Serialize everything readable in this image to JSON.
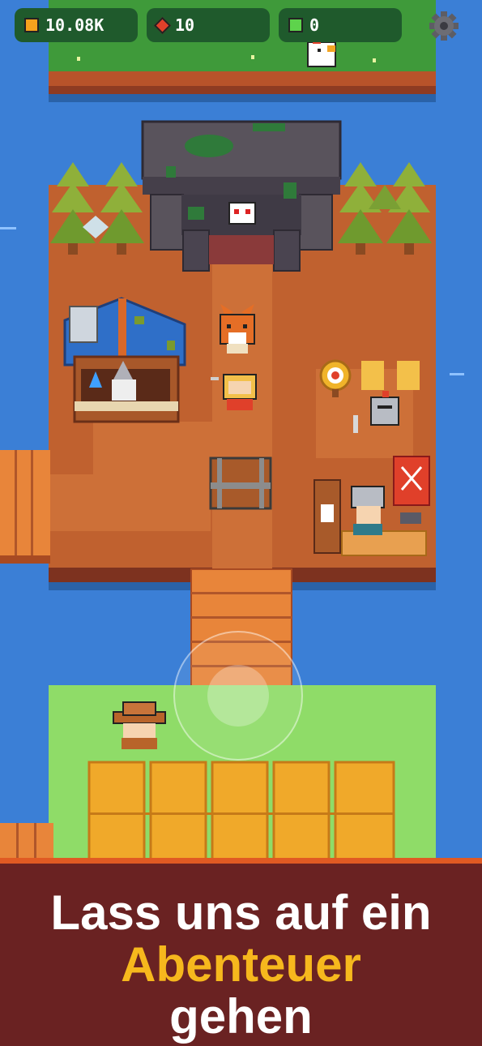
{
  "hud": {
    "gold": {
      "value": "10.08K",
      "icon": "gold-coin-icon",
      "color": "#f6a21d"
    },
    "rubies": {
      "value": "10",
      "icon": "ruby-icon",
      "color": "#e0402a"
    },
    "gems": {
      "value": "0",
      "icon": "green-gem-icon",
      "color": "#5ed34c"
    },
    "settings_icon": "gear-icon"
  },
  "banner": {
    "line1": "Lass uns auf ein",
    "line2": "Abenteuer",
    "line3": "gehen",
    "accent_color": "#f6b81d",
    "background_color": "#6a2222"
  },
  "colors": {
    "water": "#3b7fd6",
    "grass": "#8fdc68",
    "dirt": "#c0612f",
    "wheat": "#f0a92a"
  }
}
